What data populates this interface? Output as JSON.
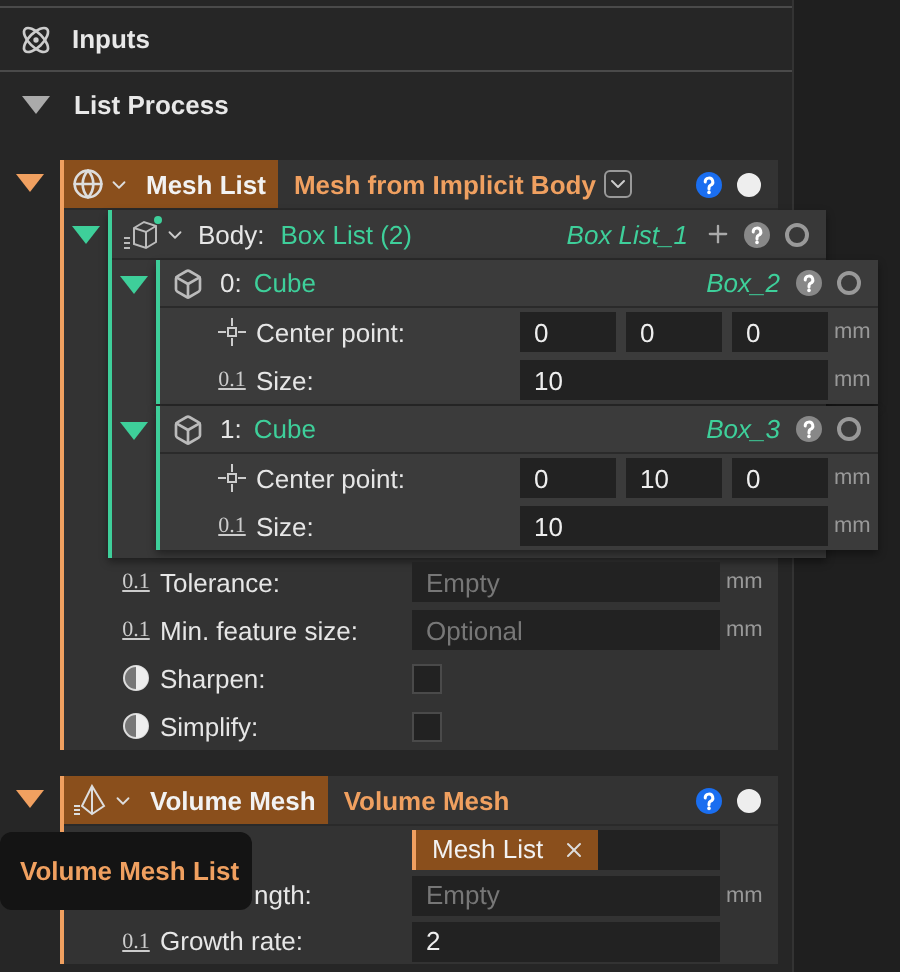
{
  "header": {
    "title": "Inputs"
  },
  "section": {
    "title": "List Process",
    "expanded": true
  },
  "nodes": [
    {
      "kind": "mesh_list",
      "expanded": true,
      "badge": "Mesh List",
      "title": "Mesh from Implicit Body",
      "body": {
        "label": "Body:",
        "value": "Box List (2)",
        "name": "Box List_1",
        "expanded": true,
        "items": [
          {
            "index": "0:",
            "type": "Cube",
            "name": "Box_2",
            "expanded": true,
            "params": [
              {
                "kind": "point",
                "label": "Center point:",
                "values": [
                  "0",
                  "0",
                  "0"
                ],
                "unit": "mm"
              },
              {
                "kind": "number",
                "icon_text": "0.1",
                "label": "Size:",
                "value": "10",
                "unit": "mm"
              }
            ]
          },
          {
            "index": "1:",
            "type": "Cube",
            "name": "Box_3",
            "expanded": true,
            "params": [
              {
                "kind": "point",
                "label": "Center point:",
                "values": [
                  "0",
                  "10",
                  "0"
                ],
                "unit": "mm"
              },
              {
                "kind": "number",
                "icon_text": "0.1",
                "label": "Size:",
                "value": "10",
                "unit": "mm"
              }
            ]
          }
        ]
      },
      "params": [
        {
          "kind": "number",
          "icon_text": "0.1",
          "label": "Tolerance:",
          "placeholder": "Empty",
          "unit": "mm"
        },
        {
          "kind": "number",
          "icon_text": "0.1",
          "label": "Min. feature size:",
          "placeholder": "Optional",
          "unit": "mm"
        },
        {
          "kind": "toggle",
          "label": "Sharpen:",
          "checked": false
        },
        {
          "kind": "toggle",
          "label": "Simplify:",
          "checked": false
        }
      ]
    },
    {
      "kind": "volume_mesh",
      "expanded": true,
      "badge": "Volume Mesh",
      "title": "Volume Mesh",
      "tooltip": "Volume Mesh List",
      "params": [
        {
          "kind": "reference",
          "chip": "Mesh List"
        },
        {
          "kind": "edge",
          "label": "ngth:",
          "placeholder": "Empty",
          "unit": "mm"
        },
        {
          "kind": "number",
          "icon_text": "0.1",
          "label": "Growth rate:",
          "value": "2"
        }
      ]
    }
  ]
}
